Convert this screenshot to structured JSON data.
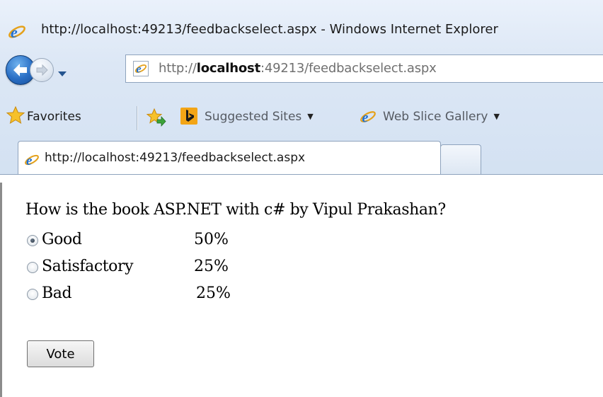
{
  "window": {
    "title": "http://localhost:49213/feedbackselect.aspx - Windows Internet Explorer"
  },
  "address_bar": {
    "prefix": "http://",
    "host": "localhost",
    "suffix": ":49213/feedbackselect.aspx"
  },
  "favorites_bar": {
    "favorites_label": "Favorites",
    "items": [
      {
        "label": "Suggested Sites",
        "icon": "bing-icon",
        "has_dropdown": true
      },
      {
        "label": "Web Slice Gallery",
        "icon": "ie-icon",
        "has_dropdown": true
      }
    ]
  },
  "tabs": [
    {
      "label": "http://localhost:49213/feedbackselect.aspx",
      "active": true
    }
  ],
  "poll": {
    "question": "How is the book ASP.NET with c# by Vipul Prakashan?",
    "options": [
      {
        "label": "Good",
        "percent": "50%",
        "selected": true
      },
      {
        "label": "Satisfactory",
        "percent": "25%",
        "selected": false
      },
      {
        "label": "Bad",
        "percent": "25%",
        "selected": false
      }
    ],
    "vote_label": "Vote"
  },
  "colors": {
    "chrome_bg": "#dce7f5",
    "border": "#8ea3bd",
    "ie_blue": "#2a6fc5"
  }
}
